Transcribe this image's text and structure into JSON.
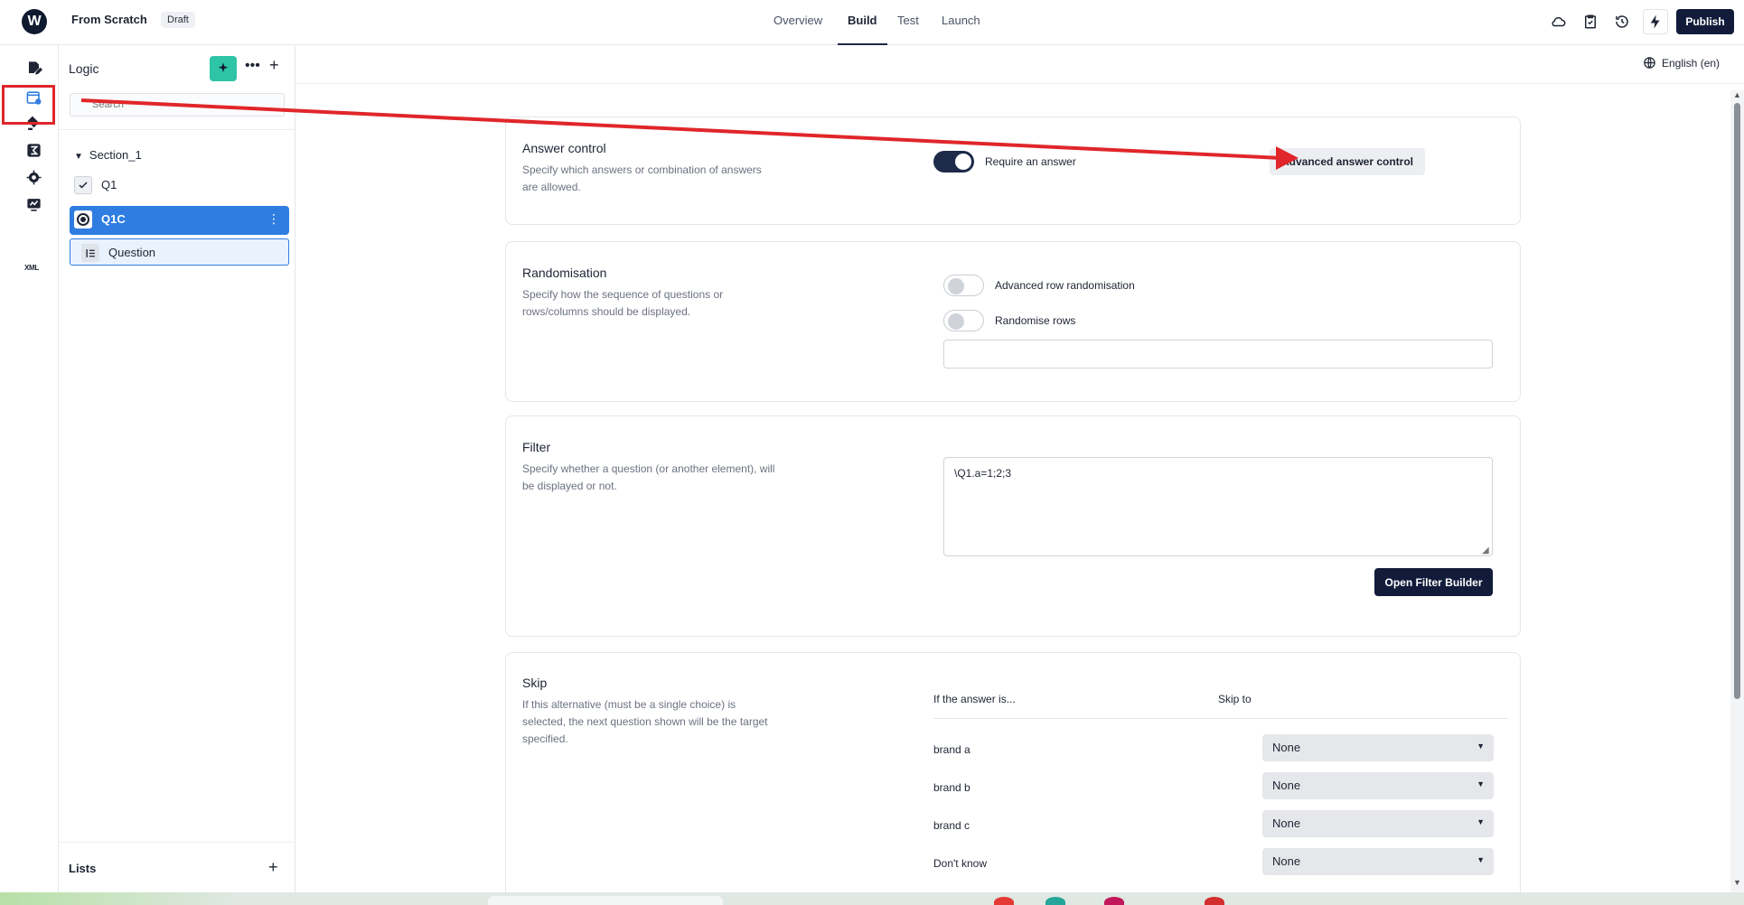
{
  "topbar": {
    "project_title": "From Scratch",
    "status_badge": "Draft",
    "tabs": [
      {
        "label": "Overview"
      },
      {
        "label": "Build"
      },
      {
        "label": "Test"
      },
      {
        "label": "Launch"
      }
    ],
    "active_tab": "Build",
    "publish_label": "Publish",
    "icons": [
      "cloud-icon",
      "checklist-icon",
      "history-icon",
      "bolt-icon"
    ]
  },
  "rail": {
    "icons": [
      "edit-icon",
      "logic-icon",
      "paint-bucket-icon",
      "formula-icon",
      "settings-icon",
      "monitor-icon",
      "xml-icon"
    ],
    "xml_label": "XML",
    "highlighted": "logic-icon"
  },
  "panel": {
    "title": "Logic",
    "search_placeholder": "Search",
    "section": "Section_1",
    "items": [
      {
        "label": "Q1",
        "type": "checkbox"
      },
      {
        "label": "Q1C",
        "type": "radio",
        "selected": true
      },
      {
        "label": "Question",
        "type": "list"
      }
    ],
    "lists_label": "Lists"
  },
  "main": {
    "language": "English (en)",
    "answer_control": {
      "title": "Answer control",
      "description": "Specify which answers or combination of answers are allowed.",
      "toggle_label": "Require an answer",
      "toggle_on": true,
      "button": "Advanced answer control"
    },
    "randomisation": {
      "title": "Randomisation",
      "description": "Specify how the sequence of questions or rows/columns should be displayed.",
      "toggle1_label": "Advanced row randomisation",
      "toggle2_label": "Randomise rows",
      "input_value": ""
    },
    "filter": {
      "title": "Filter",
      "description": "Specify whether a question (or another element), will be displayed or not.",
      "expression": "\\Q1.a=1;2;3",
      "button": "Open Filter Builder"
    },
    "skip": {
      "title": "Skip",
      "description": "If this alternative (must be a single choice) is selected, the next question shown will be the target specified.",
      "col_answer": "If the answer is...",
      "col_skip": "Skip to",
      "rows": [
        {
          "answer": "brand a",
          "target": "None"
        },
        {
          "answer": "brand b",
          "target": "None"
        },
        {
          "answer": "brand c",
          "target": "None"
        },
        {
          "answer": "Don't know",
          "target": "None"
        }
      ]
    }
  },
  "colors": {
    "primary_dark": "#121c3a",
    "selection_blue": "#2f7de1",
    "accent_teal": "#2ec4a6",
    "annotation_red": "#e0262a"
  }
}
